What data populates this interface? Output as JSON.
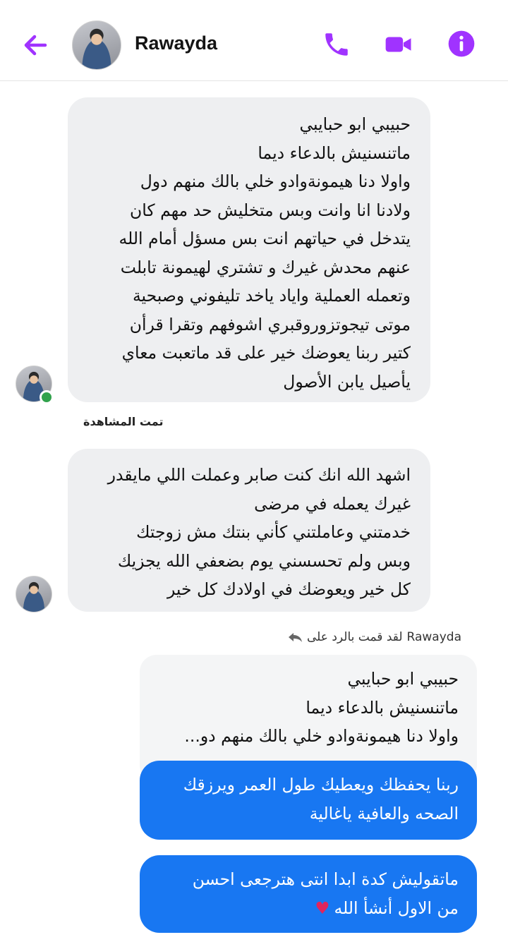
{
  "header": {
    "contact_name": "Rawayda",
    "icons": {
      "back": "arrow-left-icon",
      "call": "phone-icon",
      "video": "video-camera-icon",
      "info": "info-icon"
    },
    "accent_color": "#a033ff"
  },
  "messages": [
    {
      "direction": "incoming",
      "lines": [
        "حبيبي ابو حبايبي",
        "ماتنسنيش بالدعاء ديما",
        "واولا دنا هيمونةوادو خلي بالك منهم دول",
        "ولادنا انا وانت وبس متخليش حد مهم كان",
        "يتدخل في حياتهم انت بس مسؤل أمام الله",
        "عنهم محدش غيرك و تشتري لهيمونة تابلت",
        "وتعمله العملية واياد ياخد تليفوني وصبحية",
        "موتى تيجوتزوروقبري اشوفهم وتقرا قرأن",
        "كتير ربنا يعوضك خير على قد ماتعبت معاي",
        "يأصيل يابن الأصول"
      ]
    },
    {
      "direction": "incoming",
      "lines": [
        "اشهد الله انك كنت صابر وعملت اللي مايقدر",
        "غيرك يعمله في مرضى",
        "خدمتني وعاملتني كأني بنتك مش زوجتك",
        "وبس ولم تحسسني يوم بضعفي الله يجزيك",
        "كل خير ويعوضك في اولادك كل خير"
      ]
    }
  ],
  "seen_label": "تمت المشاهدة",
  "reply_note": {
    "text": "لقد قمت بالرد على",
    "name": "Rawayda",
    "icon": "reply-arrow-icon"
  },
  "quoted": {
    "lines": [
      "حبيبي ابو حبايبي",
      "ماتنسنيش بالدعاء ديما",
      "واولا دنا هيمونةوادو خلي بالك منهم دو..."
    ]
  },
  "outgoing": [
    {
      "lines": [
        "ربنا يحفظك ويعطيك طول العمر ويرزقك",
        "الصحه والعافية ياغالية"
      ]
    },
    {
      "lines": [
        "ماتقوليش كدة ابدا انتى هترجعى احسن",
        "من الاول أنشأ الله"
      ],
      "emoji": "♥"
    }
  ],
  "colors": {
    "incoming_bubble": "#eeeff1",
    "outgoing_bubble": "#1877f2",
    "online": "#31a24c"
  }
}
